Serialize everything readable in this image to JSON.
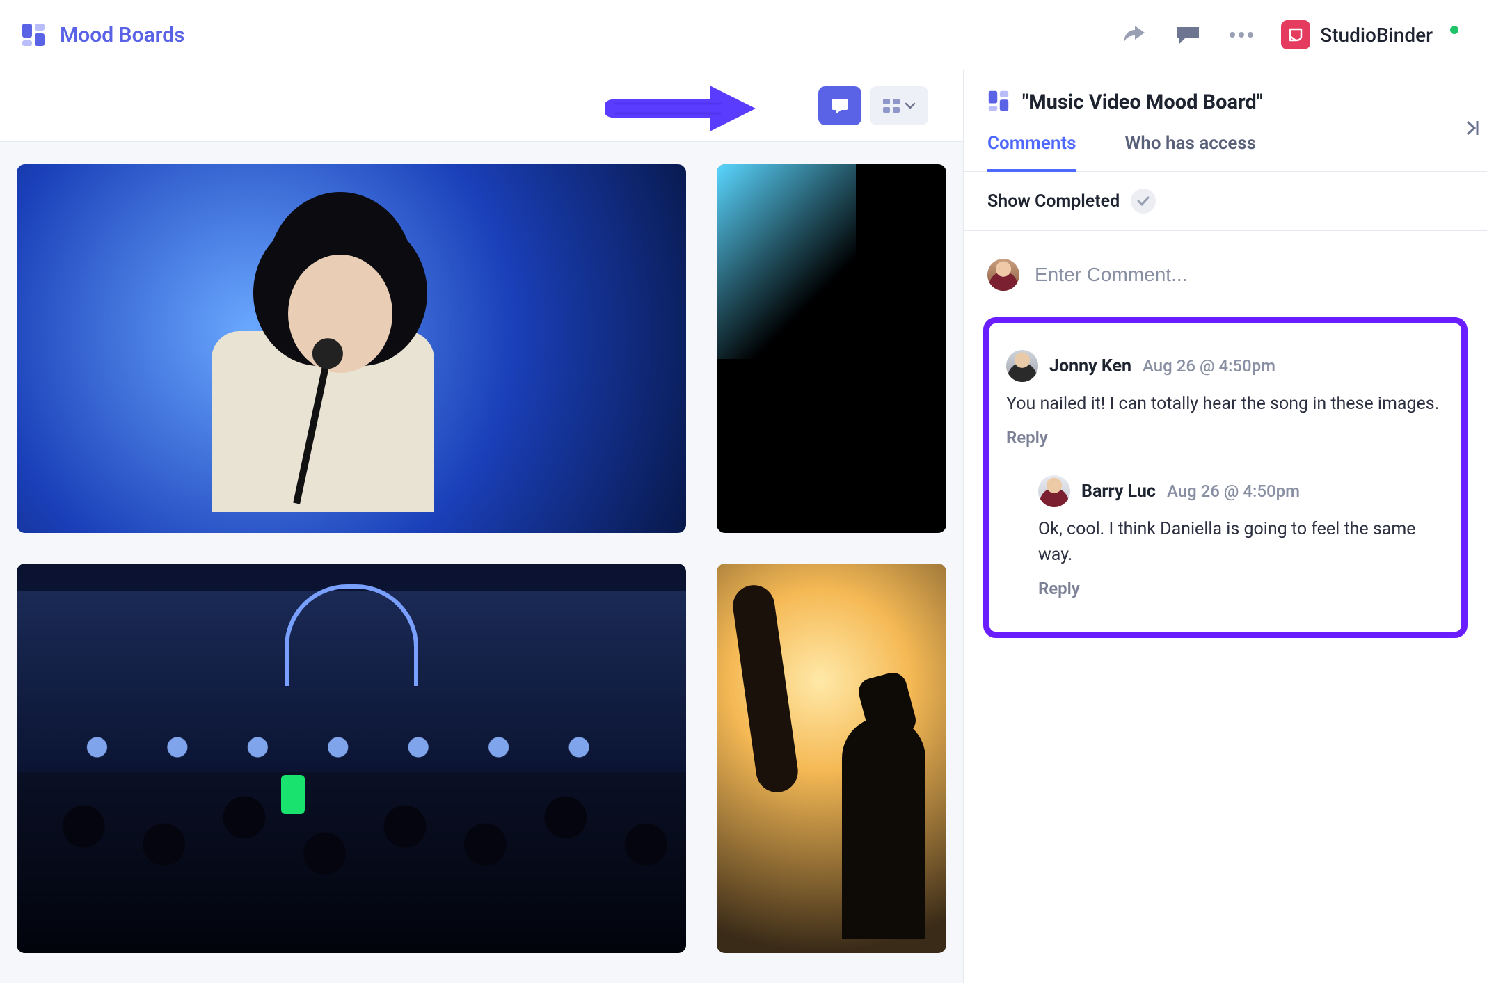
{
  "header": {
    "page_title": "Mood Boards",
    "brand_name": "StudioBinder"
  },
  "panel": {
    "title": "\"Music Video Mood Board\"",
    "tabs": {
      "comments": "Comments",
      "access": "Who has access"
    },
    "show_completed_label": "Show Completed",
    "input_placeholder": "Enter Comment...",
    "comments": [
      {
        "author": "Jonny Ken",
        "time": "Aug 26 @ 4:50pm",
        "body": "You nailed it! I can totally hear the song in these images.",
        "reply_label": "Reply"
      },
      {
        "author": "Barry Luc",
        "time": "Aug 26 @ 4:50pm",
        "body": "Ok, cool. I think Daniella is going to feel the same way.",
        "reply_label": "Reply"
      }
    ]
  }
}
